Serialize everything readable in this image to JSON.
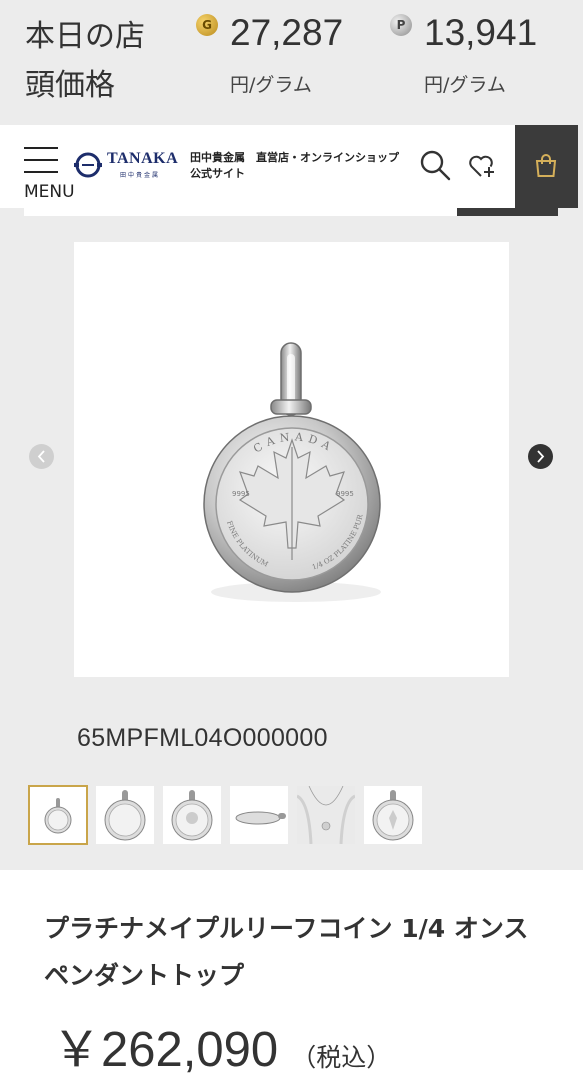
{
  "ticker": {
    "label": "本日の店頭価格",
    "gold": {
      "badge": "G",
      "price": "27,287",
      "unit": "円/グラム"
    },
    "platinum": {
      "badge": "P",
      "price": "13,941",
      "unit": "円/グラム"
    }
  },
  "header": {
    "menu_label": "MENU",
    "logo_text": "TANAKA",
    "logo_sub": "田中貴金属",
    "tagline": "田中貴金属　直営店・オンラインショップ 公式サイト",
    "icons": [
      "search-icon",
      "heart-plus-icon",
      "shopping-bag-icon"
    ]
  },
  "product": {
    "sku": "65MPFML04O000000",
    "title": "プラチナメイプルリーフコイン 1/4 オンス ペンダントトップ",
    "price": "￥262,090",
    "tax_note": "（税込）",
    "coin_text": {
      "top": "CANADA",
      "left_num": "9995",
      "right_num": "9995",
      "left_arc": "FINE PLATINUM",
      "right_arc": "1/4 OZ PLATINE PUR"
    }
  },
  "colors": {
    "accent_gold": "#c9a54a",
    "dark": "#3b3b3b",
    "logo_navy": "#1d2d6b"
  }
}
